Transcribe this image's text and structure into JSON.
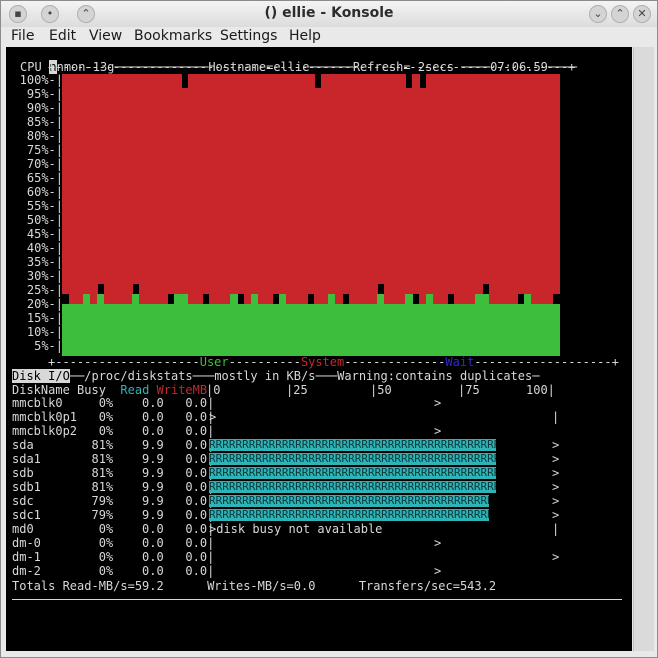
{
  "window": {
    "title": "() ellie - Konsole"
  },
  "menu": [
    "File",
    "Edit",
    "View",
    "Bookmarks",
    "Settings",
    "Help"
  ],
  "header": {
    "app": "nmon-13g",
    "host": "Hostname=ellie",
    "refresh": "Refresh= 2secs",
    "time": "07:06.59"
  },
  "cpu": {
    "label": "CPU",
    "ticks": [
      "100%-|",
      "95%-|",
      "90%-|",
      "85%-|",
      "80%-|",
      "75%-|",
      "70%-|",
      "65%-|",
      "60%-|",
      "55%-|",
      "50%-|",
      "45%-|",
      "40%-|",
      "35%-|",
      "30%-|",
      "25%-|",
      "20%-|",
      "15%-|",
      "10%-|",
      "5%-|"
    ],
    "legend": {
      "user": "User",
      "system": "System",
      "wait": "Wait"
    },
    "colors": {
      "user": "#3dbf3d",
      "system": "#c8262b",
      "wait": "#2a2ad0"
    }
  },
  "disk": {
    "title": "Disk I/O",
    "source": "/proc/diskstats",
    "unit": "mostly in KB/s",
    "warning": "Warning:contains duplicates",
    "scale": [
      "|0",
      "|25",
      "|50",
      "|75",
      "100|"
    ],
    "headers": {
      "name": "DiskName",
      "busy": "Busy",
      "read": "Read",
      "write": "WriteMB"
    },
    "rows": [
      {
        "name": "mmcblk0",
        "busy": "0%",
        "read": "0.0",
        "write": "0.0|",
        "bar": 0,
        "text": "",
        "end": ">"
      },
      {
        "name": "mmcblk0p1",
        "busy": "0%",
        "read": "0.0",
        "write": "0.0|",
        "bar": 0,
        "text": ">",
        "end": "|"
      },
      {
        "name": "mmcblk0p2",
        "busy": "0%",
        "read": "0.0",
        "write": "0.0|",
        "bar": 0,
        "text": "",
        "end": ">"
      },
      {
        "name": "sda",
        "busy": "81%",
        "read": "9.9",
        "write": "0.0|",
        "bar": 81,
        "text": "",
        "end": ">"
      },
      {
        "name": "sda1",
        "busy": "81%",
        "read": "9.9",
        "write": "0.0|",
        "bar": 81,
        "text": "",
        "end": ">"
      },
      {
        "name": "sdb",
        "busy": "81%",
        "read": "9.9",
        "write": "0.0|",
        "bar": 81,
        "text": "",
        "end": ">"
      },
      {
        "name": "sdb1",
        "busy": "81%",
        "read": "9.9",
        "write": "0.0|",
        "bar": 81,
        "text": "",
        "end": ">"
      },
      {
        "name": "sdc",
        "busy": "79%",
        "read": "9.9",
        "write": "0.0|",
        "bar": 79,
        "text": "",
        "end": ">"
      },
      {
        "name": "sdc1",
        "busy": "79%",
        "read": "9.9",
        "write": "0.0|",
        "bar": 79,
        "text": "",
        "end": ">"
      },
      {
        "name": "md0",
        "busy": "0%",
        "read": "0.0",
        "write": "0.0|",
        "bar": 0,
        "text": ">disk busy not available",
        "end": "|"
      },
      {
        "name": "dm-0",
        "busy": "0%",
        "read": "0.0",
        "write": "0.0|",
        "bar": 0,
        "text": "",
        "end": ">"
      },
      {
        "name": "dm-1",
        "busy": "0%",
        "read": "0.0",
        "write": "0.0|",
        "bar": 0,
        "text": "",
        "end": ">"
      },
      {
        "name": "dm-2",
        "busy": "0%",
        "read": "0.0",
        "write": "0.0|",
        "bar": 0,
        "text": "",
        "end": ">"
      }
    ],
    "totals": {
      "read": "Totals Read-MB/s=59.2",
      "write": "Writes-MB/s=0.0",
      "transfers": "Transfers/sec=543.2"
    }
  }
}
